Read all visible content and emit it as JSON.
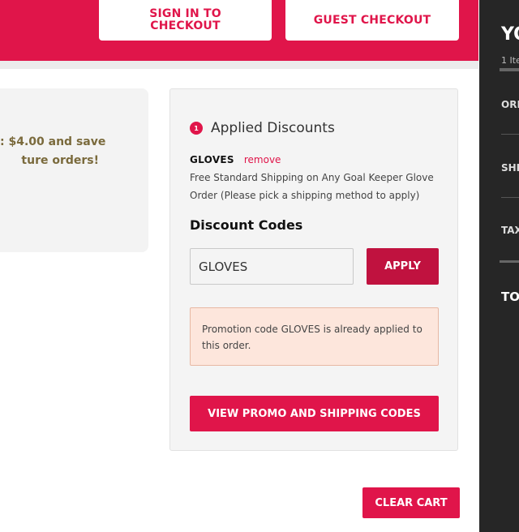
{
  "header": {
    "sign_in_line1": "SIGN IN TO",
    "sign_in_line2": "CHECKOUT",
    "guest_checkout": "GUEST CHECKOUT"
  },
  "promo_banner": {
    "line1": ": $4.00 and save",
    "line2": "ture orders!"
  },
  "discounts": {
    "count": "1",
    "title": "Applied Discounts",
    "applied_code": "GLOVES",
    "remove_label": "remove",
    "description": "Free Standard Shipping on Any Goal Keeper Glove Order (Please pick a shipping method to apply)",
    "codes_heading": "Discount Codes",
    "input_value": "GLOVES",
    "apply_label": "APPLY",
    "notice": "Promotion code GLOVES is already applied to this order.",
    "view_promo_label": "VIEW PROMO AND SHIPPING CODES"
  },
  "clear_cart_label": "CLEAR CART",
  "summary": {
    "title": "YO",
    "items": "1 Ite",
    "order_label": "ORI",
    "shipping_label": "SHI",
    "tax_label": "TAX",
    "total_label": "TO"
  },
  "colors": {
    "brand_red": "#e0154a",
    "apply_red": "#c0123f",
    "notice_bg": "#fde6dc",
    "summary_bg": "#262626"
  }
}
